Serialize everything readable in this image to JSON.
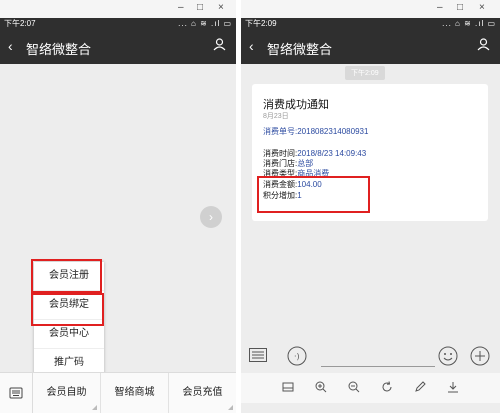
{
  "left": {
    "window_controls": [
      "–",
      "□",
      "×"
    ],
    "status": {
      "time": "下午2:07",
      "icons": "... ⌂ ≋ .ıl ▭"
    },
    "header": {
      "back": "‹",
      "title": "智络微整合",
      "user_icon": "user-icon"
    },
    "popup_menu": [
      "会员注册",
      "会员绑定",
      "会员中心",
      "推广码"
    ],
    "bottom_menu": {
      "keyboard_icon": "keyboard-icon",
      "items": [
        "会员自助",
        "智络商城",
        "会员充值"
      ]
    },
    "floating_button": "›"
  },
  "right": {
    "window_controls": [
      "–",
      "□",
      "×"
    ],
    "status": {
      "time": "下午2:09",
      "icons": "... ⌂ ≋ .ıl ▭"
    },
    "header": {
      "back": "‹",
      "title": "智络微整合",
      "user_icon": "user-icon"
    },
    "timestamp": "下午2:09",
    "card": {
      "title": "消费成功通知",
      "date": "8月23日",
      "order_label": "消费单号:",
      "order_value": "2018082314080931",
      "rows": [
        {
          "label": "消费时间:",
          "value": "2018/8/23 14:09:43"
        },
        {
          "label": "消费门店:",
          "value": "总部"
        },
        {
          "label": "消费类型:",
          "value": "商品消费"
        },
        {
          "label": "消费金额:",
          "value": "104.00"
        },
        {
          "label": "积分增加:",
          "value": "1"
        }
      ]
    },
    "input_bar": {
      "menu_icon": "list-icon",
      "voice_icon": "voice-icon",
      "emoji_icon": "emoji-icon",
      "plus_icon": "plus-icon"
    },
    "toolbar_icons": [
      "save-icon",
      "zoom-in-icon",
      "zoom-out-icon",
      "rotate-icon",
      "edit-icon",
      "download-icon"
    ]
  },
  "colors": {
    "header_bg": "#2f2f2f",
    "highlight": "#e02020",
    "link": "#2b4aa0"
  }
}
